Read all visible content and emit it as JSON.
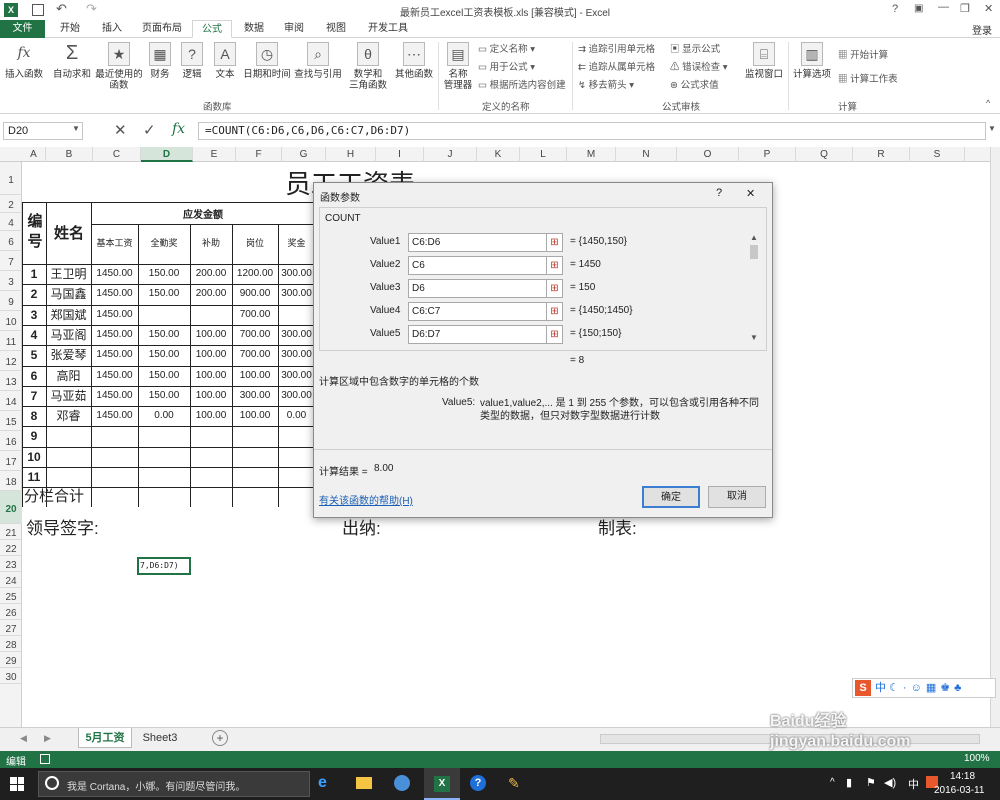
{
  "window": {
    "title": "最新员工excel工资表模板.xls  [兼容模式] - Excel",
    "login": "登录"
  },
  "tabs": [
    "文件",
    "开始",
    "插入",
    "页面布局",
    "公式",
    "数据",
    "审阅",
    "视图",
    "开发工具"
  ],
  "ribbon": {
    "insert_function": "插入函数",
    "autosum": "自动求和",
    "recent": "最近使用的\n函数",
    "financial": "财务",
    "logical": "逻辑",
    "text": "文本",
    "datetime": "日期和时间",
    "lookup": "查找与引用",
    "math": "数学和\n三角函数",
    "other": "其他函数",
    "group_library": "函数库",
    "name_manager": "名称\n管理器",
    "define_name": "定义名称",
    "use_in_formula": "用于公式",
    "create_from_selection": "根据所选内容创建",
    "group_names": "定义的名称",
    "trace_precedents": "追踪引用单元格",
    "trace_dependents": "追踪从属单元格",
    "remove_arrows": "移去箭头",
    "show_formulas": "显示公式",
    "error_checking": "错误检查",
    "evaluate_formula": "公式求值",
    "group_auditing": "公式审核",
    "watch_window": "监视窗口",
    "calc_options": "计算选项",
    "calc_now": "开始计算",
    "calc_sheet": "计算工作表",
    "group_calc": "计算"
  },
  "formula_bar": {
    "name_box": "D20",
    "formula": "=COUNT(C6:D6,C6,D6,C6:C7,D6:D7)"
  },
  "columns": [
    "A",
    "B",
    "C",
    "D",
    "E",
    "F",
    "G",
    "H",
    "I",
    "J",
    "K",
    "L",
    "M",
    "N",
    "O",
    "P",
    "Q",
    "R",
    "S"
  ],
  "rows": [
    "1",
    "2",
    "4",
    "6",
    "7",
    "3",
    "9",
    "10",
    "11",
    "12",
    "13",
    "14",
    "15",
    "16",
    "17",
    "18",
    "20",
    "21",
    "22",
    "23",
    "24",
    "25",
    "26",
    "27",
    "28",
    "29",
    "30"
  ],
  "sheet": {
    "title": "员工工资表",
    "header_no": "编号",
    "header_name": "姓名",
    "header_pay": "应发金额",
    "sub_headers": [
      "基本工资",
      "全勤奖",
      "补助",
      "岗位",
      "奖金"
    ],
    "data_rows": [
      {
        "no": "1",
        "name": "王卫明",
        "vals": [
          "1450.00",
          "150.00",
          "200.00",
          "1200.00",
          "300.00"
        ]
      },
      {
        "no": "2",
        "name": "马国鑫",
        "vals": [
          "1450.00",
          "150.00",
          "200.00",
          "900.00",
          "300.00"
        ]
      },
      {
        "no": "3",
        "name": "郑国斌",
        "vals": [
          "1450.00",
          "",
          "",
          "700.00",
          ""
        ]
      },
      {
        "no": "4",
        "name": "马亚阁",
        "vals": [
          "1450.00",
          "150.00",
          "100.00",
          "700.00",
          "300.00"
        ]
      },
      {
        "no": "5",
        "name": "张爱琴",
        "vals": [
          "1450.00",
          "150.00",
          "100.00",
          "700.00",
          "300.00"
        ]
      },
      {
        "no": "6",
        "name": "高阳",
        "vals": [
          "1450.00",
          "150.00",
          "100.00",
          "100.00",
          "300.00"
        ]
      },
      {
        "no": "7",
        "name": "马亚茹",
        "vals": [
          "1450.00",
          "150.00",
          "100.00",
          "300.00",
          "300.00"
        ]
      },
      {
        "no": "8",
        "name": "邓睿",
        "vals": [
          "1450.00",
          "0.00",
          "100.00",
          "100.00",
          "0.00"
        ]
      },
      {
        "no": "9",
        "name": "",
        "vals": [
          "",
          "",
          "",
          "",
          ""
        ]
      },
      {
        "no": "10",
        "name": "",
        "vals": [
          "",
          "",
          "",
          "",
          ""
        ]
      },
      {
        "no": "11",
        "name": "",
        "vals": [
          "",
          "",
          "",
          "",
          ""
        ]
      }
    ],
    "subtotal": "分栏合计",
    "sign_leader": "领导签字:",
    "sign_cashier": "出纳:",
    "sign_maker": "制表:",
    "active_cell_text": "7,D6:D7)"
  },
  "dialog": {
    "title": "函数参数",
    "help_glyph": "?",
    "close_glyph": "✕",
    "function_name": "COUNT",
    "args": [
      {
        "label": "Value1",
        "input": "C6:D6",
        "result": "= {1450,150}"
      },
      {
        "label": "Value2",
        "input": "C6",
        "result": "= 1450"
      },
      {
        "label": "Value3",
        "input": "D6",
        "result": "= 150"
      },
      {
        "label": "Value4",
        "input": "C6:C7",
        "result": "= {1450;1450}"
      },
      {
        "label": "Value5",
        "input": "D6:D7",
        "result": "= {150;150}"
      }
    ],
    "total": "= 8",
    "description": "计算区域中包含数字的单元格的个数",
    "param_label": "Value5:",
    "param_desc": "value1,value2,... 是 1 到 255 个参数，可以包含或引用各种不同类型的数据，但只对数字型数据进行计数",
    "result_label": "计算结果 =",
    "result_value": "8.00",
    "help_link": "有关该函数的帮助(H)",
    "ok": "确定",
    "cancel": "取消"
  },
  "sheet_tabs": [
    "5月工资",
    "Sheet3"
  ],
  "status": {
    "mode": "编辑",
    "zoom": "100%"
  },
  "taskbar": {
    "cortana": "我是 Cortana，小娜。有问题尽管问我。",
    "time": "14:18",
    "date": "2016-03-11",
    "ime": "中"
  },
  "watermark": "Baidu经验 jingyan.baidu.com"
}
